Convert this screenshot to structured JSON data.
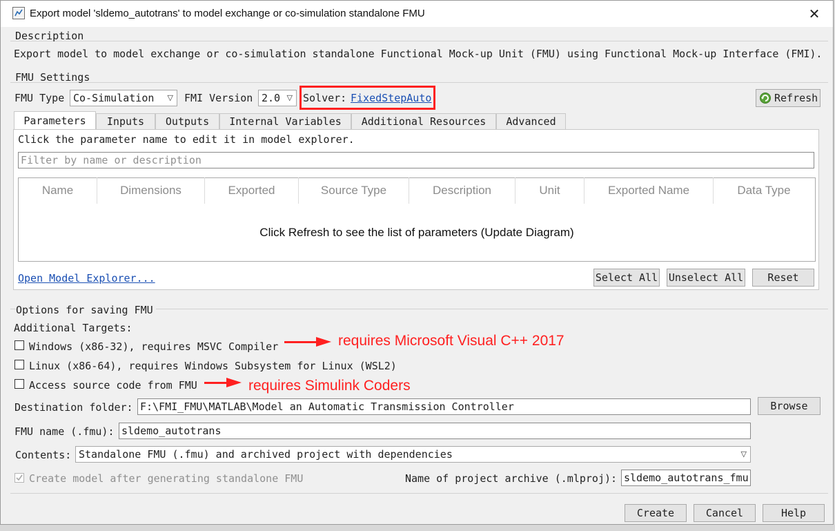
{
  "window": {
    "title": "Export model 'sldemo_autotrans' to model exchange or co-simulation standalone FMU",
    "close": "✕"
  },
  "description": {
    "heading": "Description",
    "text": "Export model to model exchange or co-simulation standalone Functional Mock-up Unit (FMU) using Functional Mock-up Interface (FMI)."
  },
  "fmu_settings": {
    "heading": "FMU Settings",
    "fmu_type_label": "FMU Type",
    "fmu_type_value": "Co-Simulation",
    "fmi_version_label": "FMI Version",
    "fmi_version_value": "2.0",
    "solver_label": "Solver:",
    "solver_link": "FixedStepAuto",
    "refresh_label": "Refresh"
  },
  "tabs": [
    "Parameters",
    "Inputs",
    "Outputs",
    "Internal Variables",
    "Additional Resources",
    "Advanced"
  ],
  "parameters": {
    "hint": "Click the parameter name to edit it in model explorer.",
    "filter_placeholder": "Filter by name or description",
    "columns": [
      "Name",
      "Dimensions",
      "Exported",
      "Source Type",
      "Description",
      "Unit",
      "Exported Name",
      "Data Type"
    ],
    "empty_message": "Click Refresh to see the list of parameters (Update Diagram)",
    "open_explorer": "Open Model Explorer...",
    "select_all": "Select All",
    "unselect_all": "Unselect All",
    "reset": "Reset"
  },
  "options": {
    "heading": "Options for saving FMU",
    "additional_targets": "Additional Targets:",
    "windows_label": "Windows (x86-32), requires MSVC Compiler",
    "linux_label": "Linux (x86-64), requires Windows Subsystem for Linux (WSL2)",
    "source_label": "Access source code from FMU",
    "dest_label": "Destination folder:",
    "dest_value": "F:\\FMI_FMU\\MATLAB\\Model an Automatic Transmission Controller",
    "browse": "Browse",
    "fmu_name_label": "FMU name (.fmu):",
    "fmu_name_value": "sldemo_autotrans",
    "contents_label": "Contents:",
    "contents_value": "Standalone FMU (.fmu) and archived project with dependencies",
    "create_model_label": "Create model after generating standalone FMU",
    "archive_label": "Name of project archive (.mlproj):",
    "archive_value": "sldemo_autotrans_fmu"
  },
  "annotations": {
    "msvc": "requires Microsoft Visual C++ 2017",
    "coders": "requires Simulink Coders",
    "color": "#ff2020"
  },
  "footer": {
    "create": "Create",
    "cancel": "Cancel",
    "help": "Help"
  }
}
